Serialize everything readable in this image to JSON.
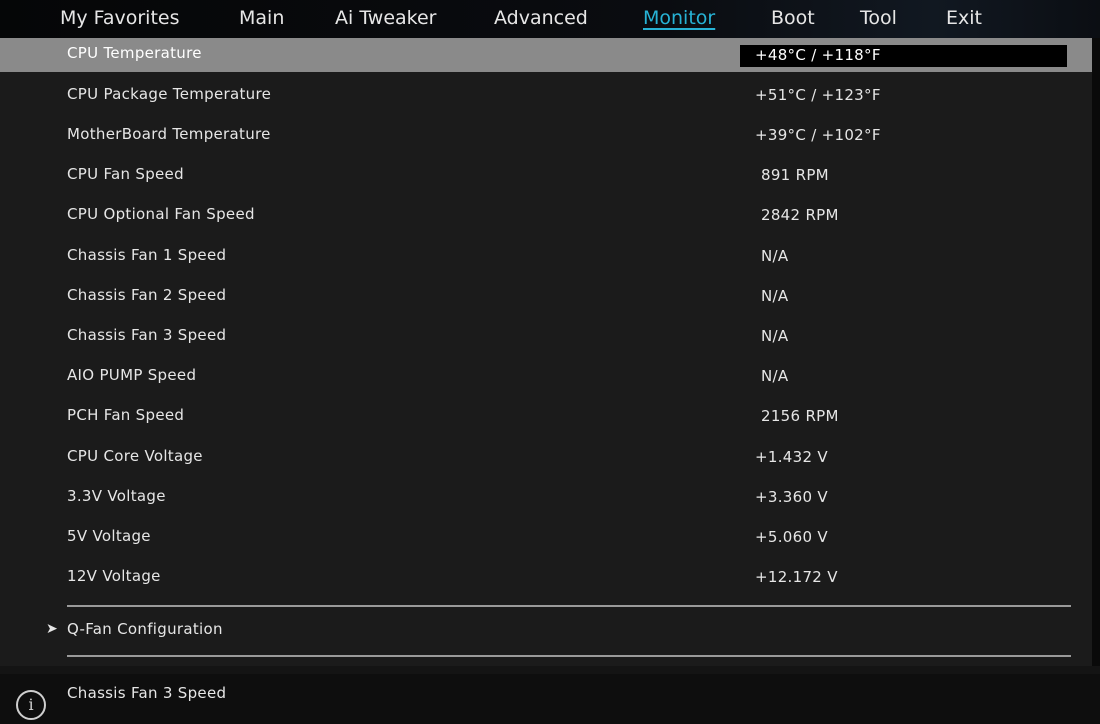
{
  "tabs": [
    {
      "label": "My Favorites"
    },
    {
      "label": "Main"
    },
    {
      "label": "Ai Tweaker"
    },
    {
      "label": "Advanced"
    },
    {
      "label": "Monitor",
      "active": true
    },
    {
      "label": "Boot"
    },
    {
      "label": "Tool"
    },
    {
      "label": "Exit"
    }
  ],
  "monitor": {
    "items": [
      {
        "label": "CPU Temperature",
        "value": "+48°C / +118°F"
      },
      {
        "label": "CPU Package Temperature",
        "value": "+51°C / +123°F"
      },
      {
        "label": "MotherBoard Temperature",
        "value": "+39°C / +102°F"
      },
      {
        "label": "CPU Fan Speed",
        "value": "891 RPM"
      },
      {
        "label": "CPU Optional Fan Speed",
        "value": "2842 RPM"
      },
      {
        "label": "Chassis Fan 1 Speed",
        "value": "N/A"
      },
      {
        "label": "Chassis Fan 2 Speed",
        "value": "N/A"
      },
      {
        "label": "Chassis Fan 3 Speed",
        "value": "N/A"
      },
      {
        "label": "AIO PUMP Speed",
        "value": "N/A"
      },
      {
        "label": "PCH Fan Speed",
        "value": "2156 RPM"
      },
      {
        "label": "CPU Core Voltage",
        "value": "+1.432 V"
      },
      {
        "label": "3.3V Voltage",
        "value": "+3.360 V"
      },
      {
        "label": "5V Voltage",
        "value": "+5.060 V"
      },
      {
        "label": "12V Voltage",
        "value": "+12.172 V"
      }
    ],
    "submenu": {
      "label": "Q-Fan Configuration"
    }
  },
  "help": {
    "text": "Chassis Fan 3 Speed",
    "icon": "info-icon"
  },
  "colors": {
    "accent": "#27b3d6",
    "selected_row": "#8a8a8a",
    "background": "#1b1b1b"
  }
}
